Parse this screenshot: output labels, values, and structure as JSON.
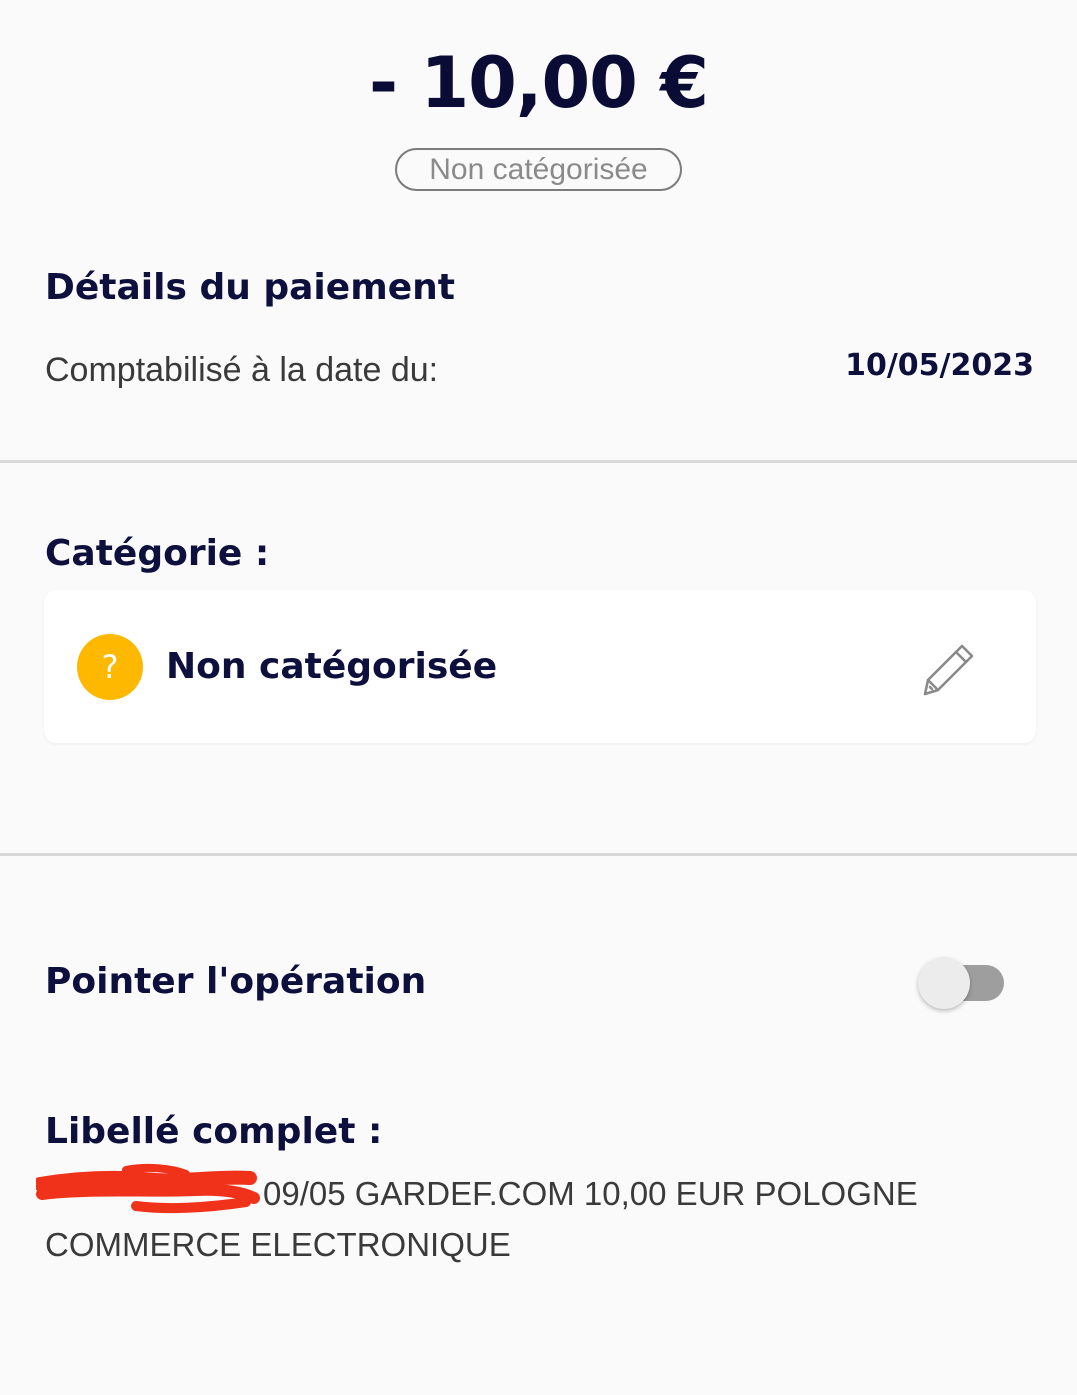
{
  "transaction": {
    "amount": "- 10,00 €",
    "category_badge": "Non catégorisée"
  },
  "payment_details": {
    "title": "Détails du paiement",
    "booked_label": "Comptabilisé à la date du:",
    "booked_date": "10/05/2023"
  },
  "category": {
    "title": "Catégorie :",
    "value": "Non catégorisée",
    "icon": "question-icon",
    "icon_color": "#ffb800",
    "edit_icon": "pencil-icon"
  },
  "pointer": {
    "label": "Pointer l'opération",
    "toggle_on": false
  },
  "full_label": {
    "title": "Libellé complet :",
    "text": "09/05 GARDEF.COM 10,00 EUR POLOGNE\nCOMMERCE ELECTRONIQUE",
    "redaction_color": "#f0321a"
  },
  "colors": {
    "navy": "#0d0f3d",
    "accent_yellow": "#ffb800",
    "background": "#fafafa"
  }
}
